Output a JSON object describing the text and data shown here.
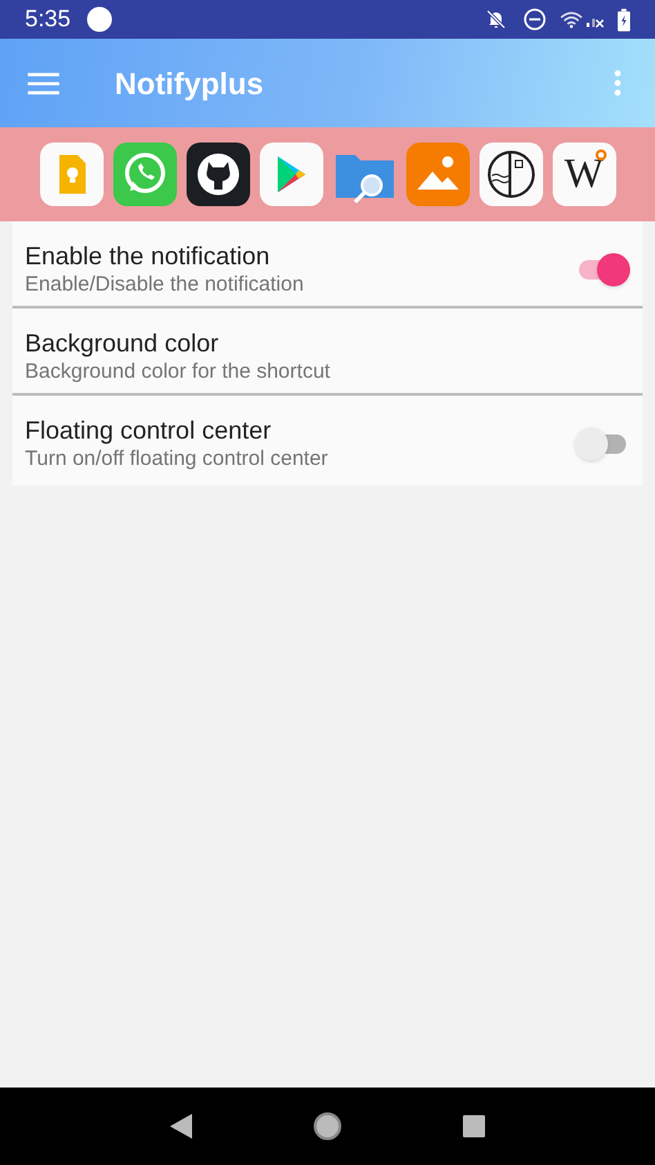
{
  "status_bar": {
    "time": "5:35"
  },
  "app_bar": {
    "title": "Notifyplus"
  },
  "shortcuts": [
    {
      "kind": "note"
    },
    {
      "kind": "chat"
    },
    {
      "kind": "cat"
    },
    {
      "kind": "play"
    },
    {
      "kind": "folder"
    },
    {
      "kind": "gallery"
    },
    {
      "kind": "circle"
    },
    {
      "kind": "letter",
      "label": "W"
    }
  ],
  "settings": [
    {
      "kind": "switch",
      "title": "Enable the notification",
      "summary": "Enable/Disable the notification",
      "on": true
    },
    {
      "kind": "plain",
      "title": "Background color",
      "summary": "Background color for the shortcut"
    },
    {
      "kind": "switch",
      "title": "Floating control center",
      "summary": "Turn on/off floating control center",
      "on": false
    }
  ]
}
